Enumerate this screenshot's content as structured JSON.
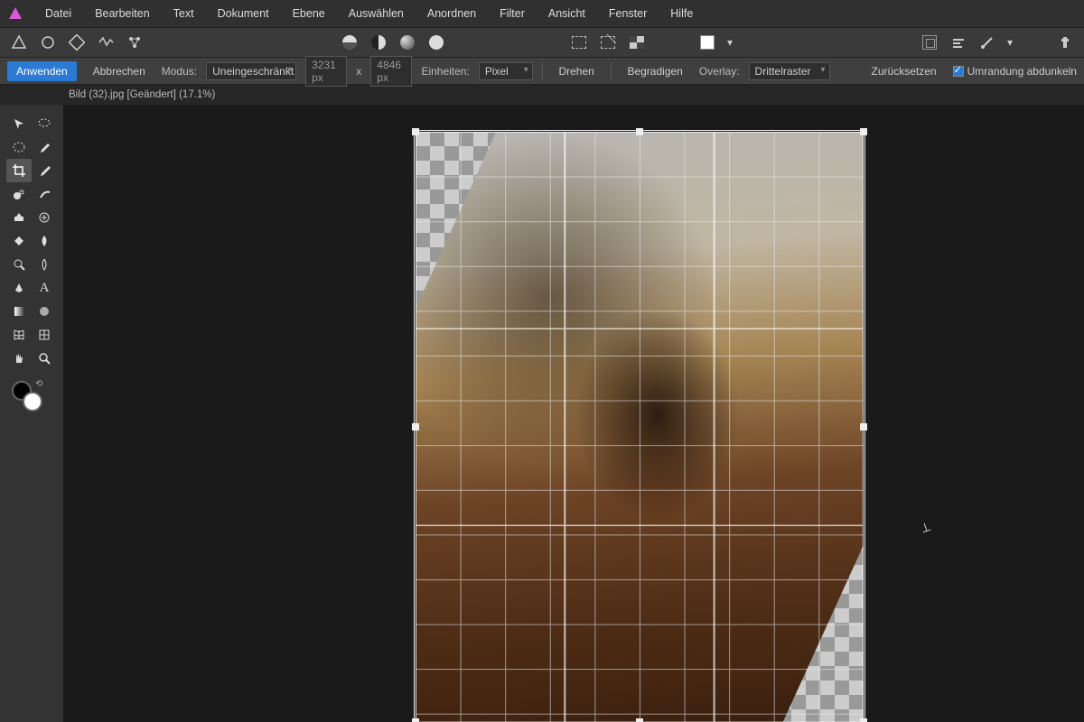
{
  "menubar": {
    "items": [
      "Datei",
      "Bearbeiten",
      "Text",
      "Dokument",
      "Ebene",
      "Auswählen",
      "Anordnen",
      "Filter",
      "Ansicht",
      "Fenster",
      "Hilfe"
    ]
  },
  "optbar": {
    "apply": "Anwenden",
    "cancel": "Abbrechen",
    "mode_label": "Modus:",
    "mode_value": "Uneingeschränkt",
    "width": "3231 px",
    "x": "x",
    "height": "4846 px",
    "units_label": "Einheiten:",
    "units_value": "Pixel",
    "rotate": "Drehen",
    "straighten": "Begradigen",
    "overlay_label": "Overlay:",
    "overlay_value": "Drittelraster",
    "reset": "Zurücksetzen",
    "darken_border": "Umrandung abdunkeln"
  },
  "doctab": {
    "title": "Bild (32).jpg [Geändert] (17.1%)"
  },
  "tools": {
    "row1": [
      "pointer",
      "lasso"
    ],
    "row2": [
      "ellipse-select",
      "eyedropper"
    ],
    "row3": [
      "crop",
      "brush"
    ],
    "row4": [
      "clone",
      "paint"
    ],
    "row5": [
      "inpaint",
      "heal"
    ],
    "row6": [
      "fill",
      "blur"
    ],
    "row7": [
      "zoom-plus",
      "smudge"
    ],
    "row8": [
      "pen",
      "text"
    ],
    "row9": [
      "bucket",
      "shape"
    ],
    "row10": [
      "mesh",
      "grid"
    ],
    "row11": [
      "hand",
      "zoom"
    ]
  }
}
